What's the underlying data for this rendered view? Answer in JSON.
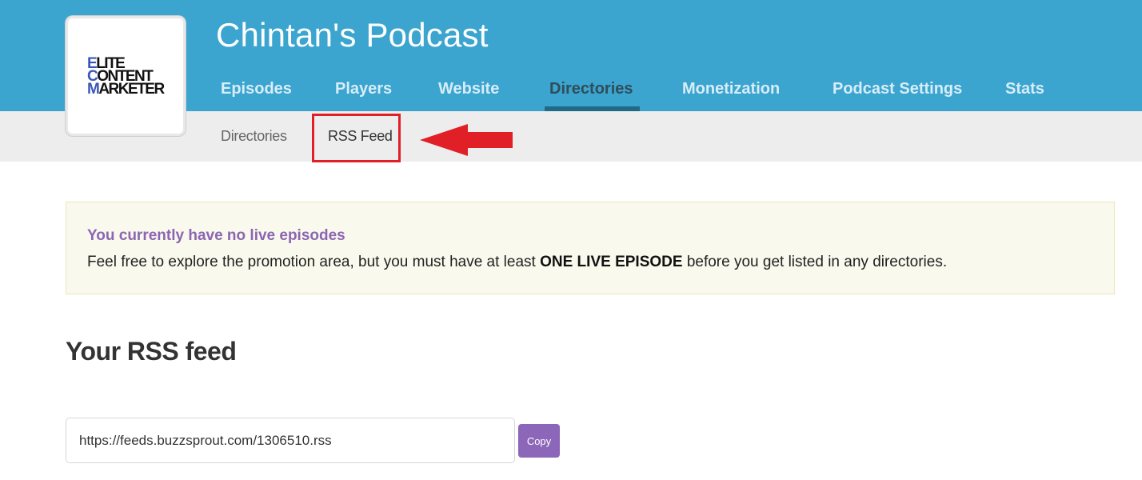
{
  "header": {
    "podcast_title": "Chintan's Podcast",
    "logo": {
      "lines": [
        "LITE",
        "ONTENT",
        "ARKETER"
      ],
      "initials": [
        "E",
        "C",
        "M"
      ],
      "accent_color": "#3a57b7"
    },
    "tabs": [
      {
        "label": "Episodes"
      },
      {
        "label": "Players"
      },
      {
        "label": "Website"
      },
      {
        "label": "Directories",
        "active": true
      },
      {
        "label": "Monetization"
      },
      {
        "label": "Podcast Settings"
      },
      {
        "label": "Stats"
      }
    ],
    "background_color": "#3ba5d0"
  },
  "subnav": {
    "items": [
      {
        "label": "Directories"
      },
      {
        "label": "RSS Feed",
        "active": true
      }
    ],
    "annotation": {
      "icon": "red-arrow-left-icon",
      "highlight_color": "#e01f26"
    }
  },
  "alert": {
    "title": "You currently have no live episodes",
    "body_prefix": "Feel free to explore the promotion area, but you must have at least ",
    "body_emphasis": "ONE LIVE EPISODE",
    "body_suffix": " before you get listed in any directories."
  },
  "rss": {
    "heading": "Your RSS feed",
    "feed_url": "https://feeds.buzzsprout.com/1306510.rss",
    "copy_label": "Copy",
    "button_color": "#8c66b8"
  }
}
